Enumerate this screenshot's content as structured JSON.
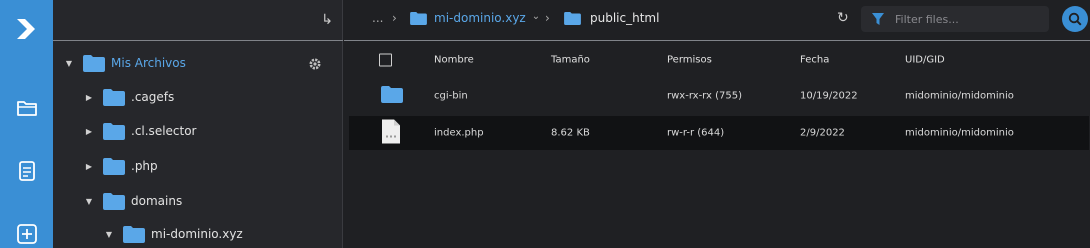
{
  "rail": {
    "items": [
      "logo-icon",
      "folder-icon",
      "file-text-icon",
      "add-icon"
    ]
  },
  "tree": {
    "up_icon": "↳",
    "root": {
      "label": "Mis Archivos"
    },
    "items": [
      {
        "label": ".cagefs"
      },
      {
        "label": ".cl.selector"
      },
      {
        "label": ".php"
      },
      {
        "label": "domains"
      },
      {
        "label": "mi-dominio.xyz"
      }
    ]
  },
  "breadcrumb": {
    "ellipsis": "...",
    "sep1": "›",
    "domain": "mi-dominio.xyz",
    "domain_caret": "⌄",
    "sep2": "›",
    "current": "public_html"
  },
  "toolbar": {
    "refresh": "↻",
    "filter_placeholder": "Filter files..."
  },
  "table": {
    "headers": {
      "name": "Nombre",
      "size": "Tamaño",
      "perms": "Permisos",
      "date": "Fecha",
      "uid": "UID/GID"
    },
    "rows": [
      {
        "name": "cgi-bin",
        "size": "",
        "perms": "rwx-rx-rx (755)",
        "date": "10/19/2022",
        "uid": "midominio/midominio",
        "type": "folder"
      },
      {
        "name": "index.php",
        "size": "8.62 KB",
        "perms": "rw-r-r (644)",
        "date": "2/9/2022",
        "uid": "midominio/midominio",
        "type": "file"
      }
    ]
  },
  "colors": {
    "accent": "#3a8fd5",
    "folder": "#5aa7e8"
  }
}
